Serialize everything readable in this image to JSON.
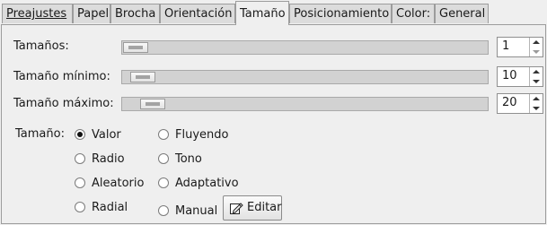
{
  "tabs": [
    {
      "label": "Preajustes",
      "active": false
    },
    {
      "label": "Papel",
      "active": false
    },
    {
      "label": "Brocha",
      "active": false
    },
    {
      "label": "Orientación",
      "active": false
    },
    {
      "label": "Tamaño",
      "active": true
    },
    {
      "label": "Posicionamiento",
      "active": false
    },
    {
      "label": "Color:",
      "active": false
    },
    {
      "label": "General",
      "active": false
    }
  ],
  "sliders": [
    {
      "label": "Tamaños:",
      "value": "1",
      "level": 0.0
    },
    {
      "label": "Tamaño mínimo:",
      "value": "10",
      "level": 0.02
    },
    {
      "label": "Tamaño máximo:",
      "value": "20",
      "level": 0.05
    }
  ],
  "size_mode": {
    "label": "Tamaño:",
    "options": [
      "Valor",
      "Radio",
      "Aleatorio",
      "Radial",
      "Fluyendo",
      "Tono",
      "Adaptativo",
      "Manual"
    ],
    "selected": "Valor"
  },
  "edit_button": {
    "label": "Editar",
    "icon": "edit-icon"
  }
}
